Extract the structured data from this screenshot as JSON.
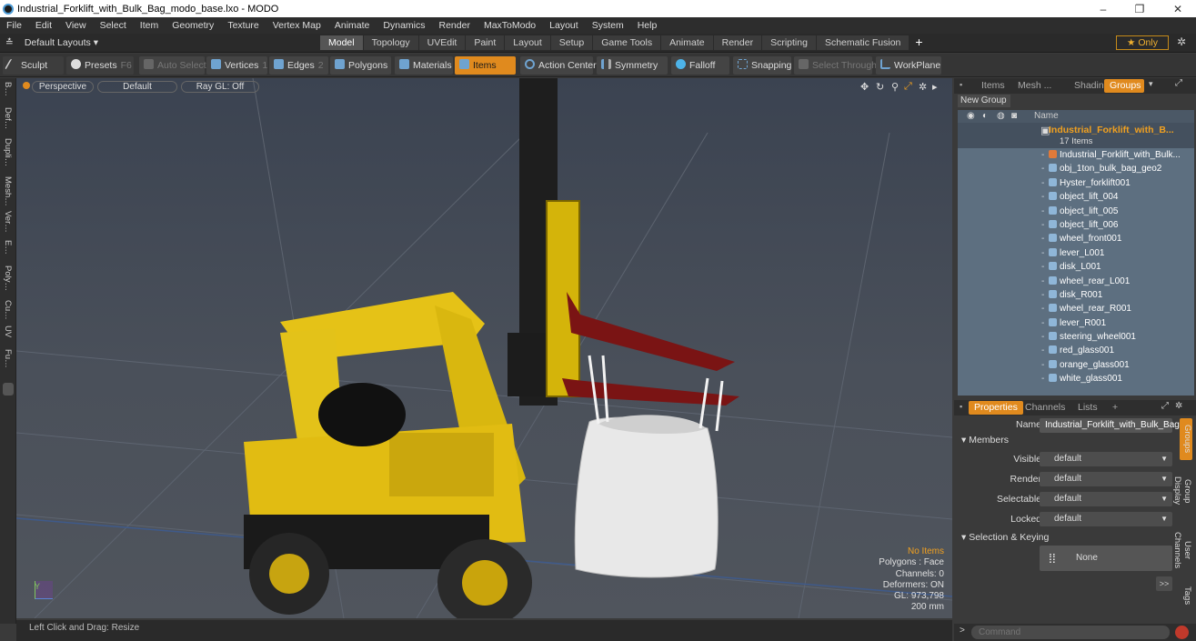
{
  "window": {
    "title": "Industrial_Forklift_with_Bulk_Bag_modo_base.lxo - MODO",
    "minimize": "–",
    "maximize": "❐",
    "close": "✕"
  },
  "menu": [
    "File",
    "Edit",
    "View",
    "Select",
    "Item",
    "Geometry",
    "Texture",
    "Vertex Map",
    "Animate",
    "Dynamics",
    "Render",
    "MaxToModo",
    "Layout",
    "System",
    "Help"
  ],
  "layoutbar": {
    "layouts": "Default Layouts ▾",
    "tabs": [
      "Model",
      "Topology",
      "UVEdit",
      "Paint",
      "Layout",
      "Setup",
      "Game Tools",
      "Animate",
      "Render",
      "Scripting",
      "Schematic Fusion"
    ],
    "active_tab": "Model",
    "plus": "+",
    "only": "★ Only",
    "gear": "✲"
  },
  "toolbar": {
    "sculpt": "Sculpt",
    "presets": "Presets",
    "presets_key": "F6",
    "auto_select": "Auto Select",
    "vertices": "Vertices",
    "vertices_count": "1",
    "edges": "Edges",
    "edges_count": "2",
    "polygons": "Polygons",
    "materials": "Materials",
    "items": "Items",
    "action_center": "Action Center",
    "symmetry": "Symmetry",
    "falloff": "Falloff",
    "snapping": "Snapping",
    "select_through": "Select Through",
    "workplane": "WorkPlane"
  },
  "left_strip": [
    "B…",
    "Def…",
    "Dupli…",
    "Mesh…",
    "Ver…",
    "E…",
    "Poly…",
    "Cu…",
    "UV",
    "Fu…"
  ],
  "viewport": {
    "view": "Perspective",
    "shading": "Default",
    "raygl": "Ray GL: Off",
    "axis_label": "Y",
    "info": {
      "items": "No Items",
      "polygons": "Polygons : Face",
      "channels": "Channels: 0",
      "deformers": "Deformers: ON",
      "gl": "GL: 973,798",
      "scale": "200 mm"
    }
  },
  "status": "Left Click and Drag:  Resize",
  "right_panel": {
    "tabs": [
      "Items",
      "Mesh ...",
      "Shading",
      "Groups"
    ],
    "active_tab": "Groups",
    "new_group": "New Group",
    "column_name": "Name",
    "group": {
      "name": "Industrial_Forklift_with_B...",
      "count": "17 Items"
    },
    "items": [
      "Industrial_Forklift_with_Bulk...",
      "obj_1ton_bulk_bag_geo2",
      "Hyster_forklift001",
      "object_lift_004",
      "object_lift_005",
      "object_lift_006",
      "wheel_front001",
      "lever_L001",
      "disk_L001",
      "wheel_rear_L001",
      "disk_R001",
      "wheel_rear_R001",
      "lever_R001",
      "steering_wheel001",
      "red_glass001",
      "orange_glass001",
      "white_glass001"
    ],
    "props_tabs": [
      "Properties",
      "Channels",
      "Lists",
      "+"
    ],
    "props_active": "Properties",
    "name_label": "Name",
    "name_value": "Industrial_Forklift_with_Bulk_Bag",
    "members_section": "Members",
    "visible_label": "Visible",
    "visible_value": "default",
    "render_label": "Render",
    "render_value": "default",
    "selectable_label": "Selectable",
    "selectable_value": "default",
    "locked_label": "Locked",
    "locked_value": "default",
    "sel_key_section": "Selection & Keying",
    "sel_key_value": "None",
    "side_tabs": [
      "Groups",
      "Group Display",
      "User Channels",
      "Tags"
    ],
    "expand": ">>",
    "command_placeholder": "Command"
  }
}
